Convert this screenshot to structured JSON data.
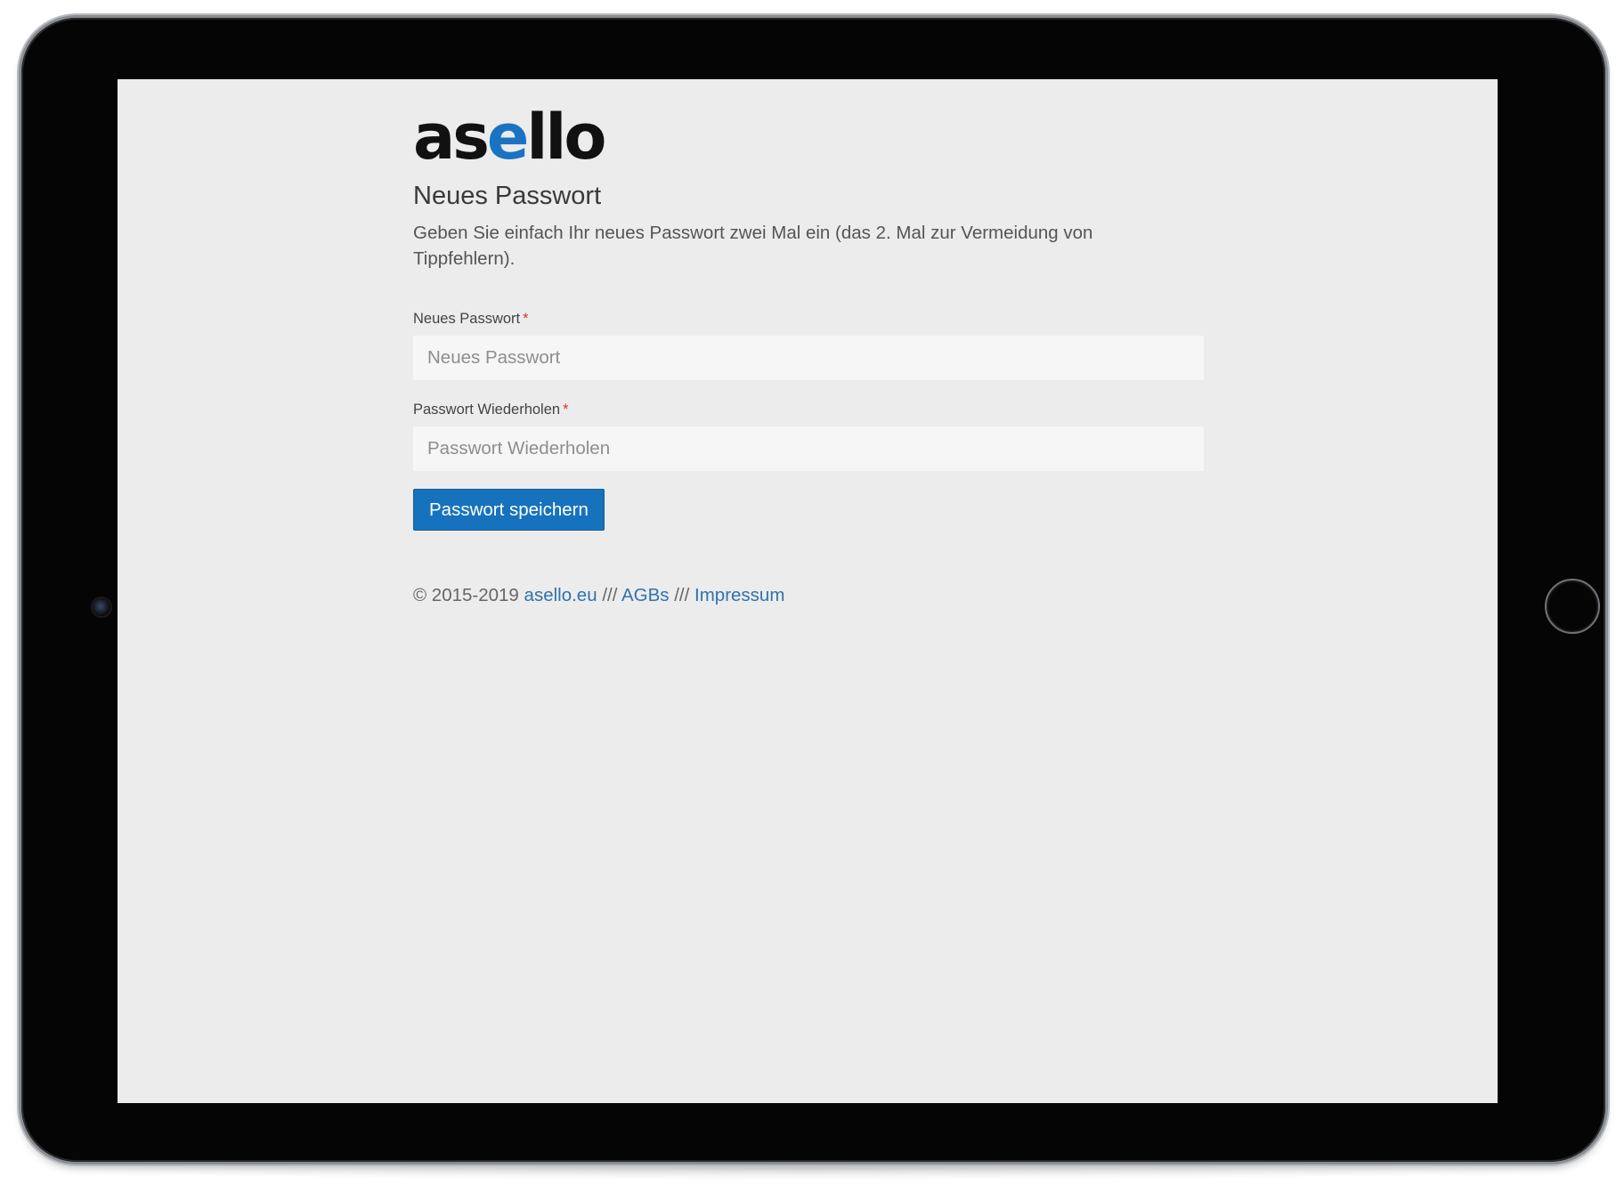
{
  "brand": {
    "logo_prefix": "as",
    "logo_accent": "e",
    "logo_suffix": "llo",
    "accent_color": "#1a73c2"
  },
  "page": {
    "title": "Neues Passwort",
    "intro": "Geben Sie einfach Ihr neues Passwort zwei Mal ein (das 2. Mal zur Vermeidung von Tippfehlern)."
  },
  "form": {
    "new_password": {
      "label": "Neues Passwort",
      "required_marker": "*",
      "placeholder": "Neues Passwort",
      "value": ""
    },
    "repeat_password": {
      "label": "Passwort Wiederholen",
      "required_marker": "*",
      "placeholder": "Passwort Wiederholen",
      "value": ""
    },
    "submit_label": "Passwort speichern"
  },
  "footer": {
    "copyright": "© 2015-2019",
    "link_site": "asello.eu",
    "separator": "///",
    "link_terms": "AGBs",
    "link_imprint": "Impressum"
  },
  "colors": {
    "primary_button": "#1672bd",
    "link": "#2f72b0",
    "required": "#d9342b",
    "screen_background": "#ececec"
  }
}
